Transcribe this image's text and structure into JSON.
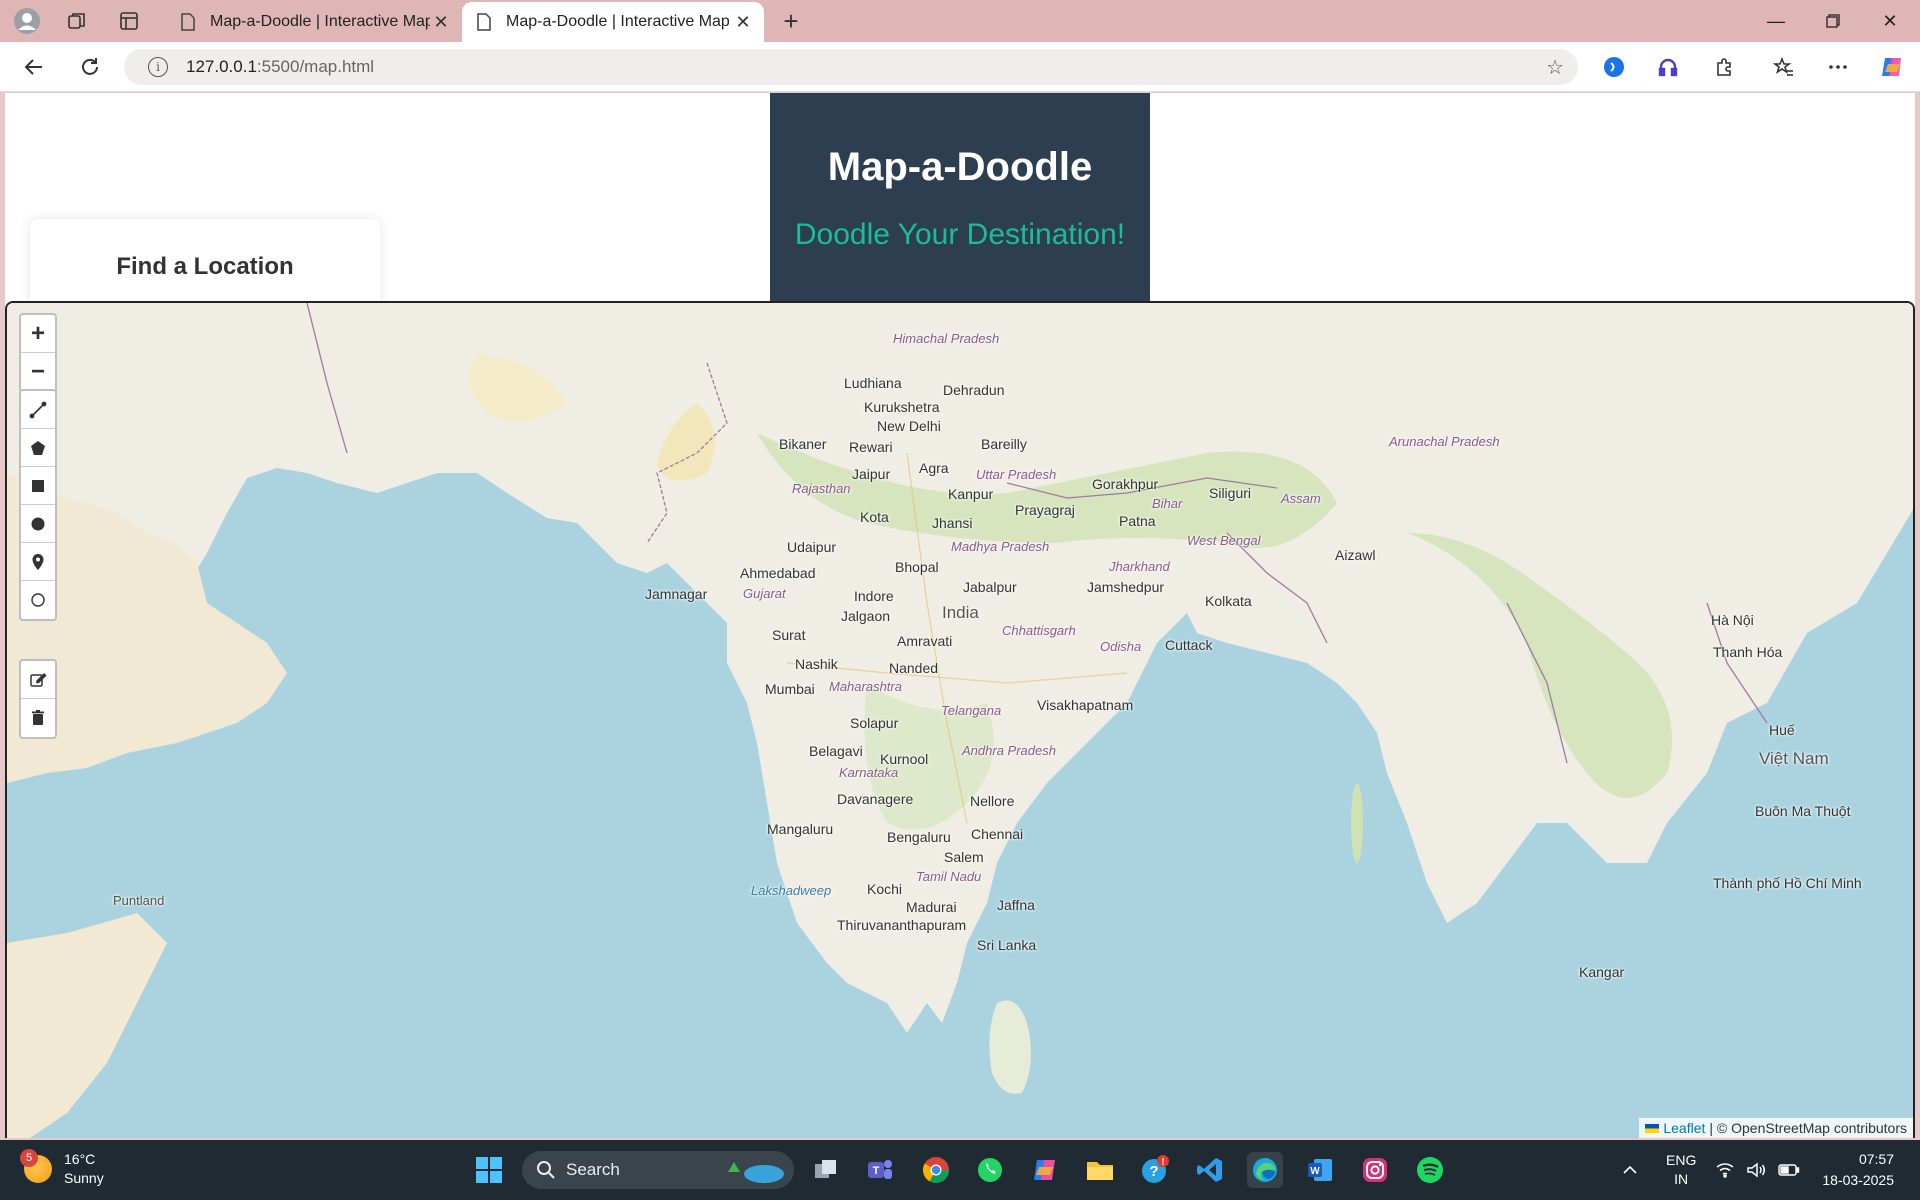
{
  "browser": {
    "tabs": [
      {
        "title": "Map-a-Doodle | Interactive Map",
        "active": false
      },
      {
        "title": "Map-a-Doodle | Interactive Map",
        "active": true
      }
    ],
    "url_host": "127.0.0.1",
    "url_path": ":5500/map.html",
    "icons": [
      "profile-icon",
      "workspaces-icon",
      "tab-actions-icon",
      "back-icon",
      "refresh-icon",
      "info-icon",
      "favorite-star-icon",
      "copilot-icon",
      "extensions-icon",
      "favorites-icon",
      "more-icon"
    ]
  },
  "header": {
    "title": "Map-a-Doodle",
    "subtitle": "Doodle Your Destination!"
  },
  "search_panel": {
    "title": "Find a Location"
  },
  "map": {
    "zoom_in": "+",
    "zoom_out": "−",
    "draw_tools": [
      "polyline-icon",
      "polygon-icon",
      "rectangle-icon",
      "circle-icon",
      "marker-icon",
      "circlemarker-icon"
    ],
    "edit_tools": [
      "edit-layers-icon",
      "delete-layers-icon"
    ],
    "labels": {
      "india": "India",
      "new_delhi": "New Delhi",
      "mumbai": "Mumbai",
      "ahmedabad": "Ahmedabad",
      "kolkata": "Kolkata",
      "chennai": "Chennai",
      "bengaluru": "Bengaluru",
      "hyderabad_region": "Telangana",
      "jaipur": "Jaipur",
      "agra": "Agra",
      "kanpur": "Kanpur",
      "lucknow_region": "Uttar Pradesh",
      "patna": "Patna",
      "bhopal": "Bhopal",
      "indore": "Indore",
      "nagpur_region": "Maharashtra",
      "surat": "Surat",
      "nashik": "Nashik",
      "solapur": "Solapur",
      "kurnool": "Kurnool",
      "nellore": "Nellore",
      "visakhapatnam": "Visakhapatnam",
      "cuttack": "Cuttack",
      "jamshedpur": "Jamshedpur",
      "jabalpur": "Jabalpur",
      "jhansi": "Jhansi",
      "kota": "Kota",
      "udaipur": "Udaipur",
      "bikaner": "Bikaner",
      "rewari": "Rewari",
      "ludhiana": "Ludhiana",
      "dehradun": "Dehradun",
      "kurukshetra": "Kurukshetra",
      "bareilly": "Bareilly",
      "gorakhpur": "Gorakhpur",
      "prayagraj": "Prayagraj",
      "siliguri": "Siliguri",
      "jalgaon": "Jalgaon",
      "amravati": "Amravati",
      "nanded": "Nanded",
      "belagavi": "Belagavi",
      "davanagere": "Davanagere",
      "mangaluru": "Mangaluru",
      "salem": "Salem",
      "kochi": "Kochi",
      "madurai": "Madurai",
      "thiruvananthapuram": "Thiruvananthapuram",
      "jaffna": "Jaffna",
      "sri_lanka": "Sri Lanka",
      "jamnagar": "Jamnagar",
      "aizawl": "Aizawl",
      "kangar": "Kangar",
      "hanoi": "Hà Nội",
      "viet_nam": "Việt Nam",
      "thanh_hoa": "Thanh Hóa",
      "hue": "Huế",
      "buon_ma_thuot": "Buôn Ma Thuột",
      "ho_chi_minh": "Thành phố Hồ Chí Minh",
      "rajasthan": "Rajasthan",
      "gujarat": "Gujarat",
      "madhya_pradesh": "Madhya Pradesh",
      "chhattisgarh": "Chhattisgarh",
      "odisha": "Odisha",
      "jharkhand": "Jharkhand",
      "bihar": "Bihar",
      "west_bengal": "West Bengal",
      "assam": "Assam",
      "arunachal": "Arunachal Pradesh",
      "himachal": "Himachal Pradesh",
      "karnataka": "Karnataka",
      "andhra": "Andhra Pradesh",
      "tamil_nadu": "Tamil Nadu",
      "lakshadweep": "Lakshadweep",
      "puntland": "Puntland"
    },
    "attribution_leaflet": "Leaflet",
    "attribution_osm": "| © OpenStreetMap contributors"
  },
  "taskbar": {
    "weather_temp": "16°C",
    "weather_desc": "Sunny",
    "weather_badge": "5",
    "search_label": "Search",
    "lang": "ENG",
    "region": "IN",
    "time": "07:57",
    "date": "18-03-2025",
    "apps": [
      "windows-start-icon",
      "task-view-icon",
      "teams-icon",
      "chrome-icon",
      "whatsapp-icon",
      "copilot-app-icon",
      "file-explorer-icon",
      "help-app-icon",
      "vscode-icon",
      "edge-icon",
      "word-icon",
      "instagram-icon",
      "spotify-icon"
    ]
  }
}
